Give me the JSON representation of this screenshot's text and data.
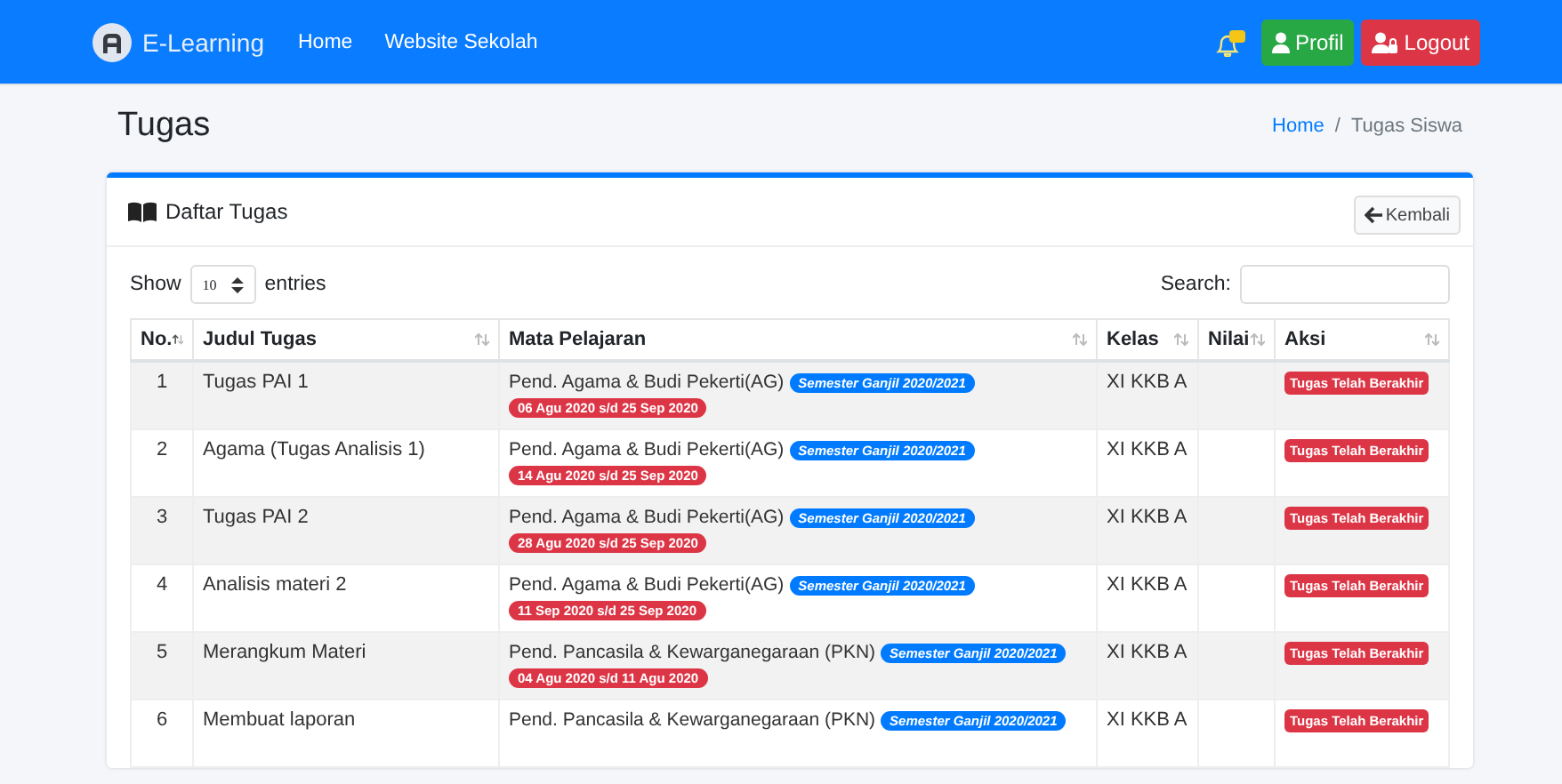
{
  "navbar": {
    "brand": "E-Learning",
    "links": [
      "Home",
      "Website Sekolah"
    ],
    "buttons": [
      {
        "label": "Profil",
        "kind": "profile"
      },
      {
        "label": "Logout",
        "kind": "logout"
      }
    ]
  },
  "page": {
    "title": "Tugas",
    "breadcrumb": [
      {
        "label": "Home",
        "selected": false
      },
      {
        "label": "Tugas Siswa",
        "selected": true
      }
    ],
    "breadcrumb_separator": "/"
  },
  "card": {
    "title": "Daftar Tugas",
    "back_button": "Kembali",
    "length": {
      "before": "Show",
      "value": "10",
      "after": "entries"
    },
    "search": {
      "label": "Search:"
    },
    "table": {
      "columns": [
        {
          "label": "No.",
          "sorted": true
        },
        {
          "label": "Judul Tugas",
          "sorted": false
        },
        {
          "label": "Mata Pelajaran",
          "sorted": false
        },
        {
          "label": "Kelas",
          "sorted": false
        },
        {
          "label": "Nilai",
          "sorted": false
        },
        {
          "label": "Aksi",
          "sorted": false
        }
      ],
      "rows": [
        {
          "no": "1",
          "title": "Tugas PAI 1",
          "subject": "Pend. Agama & Budi Pekerti(AG)",
          "semester": "Semester Ganjil 2020/2021",
          "period": "06 Agu 2020 s/d 25 Sep 2020",
          "class": "XI KKB A",
          "status": "Tugas Telah Berakhir"
        },
        {
          "no": "2",
          "title": "Agama (Tugas Analisis 1)",
          "subject": "Pend. Agama & Budi Pekerti(AG)",
          "semester": "Semester Ganjil 2020/2021",
          "period": "14 Agu 2020 s/d 25 Sep 2020",
          "class": "XI KKB A",
          "status": "Tugas Telah Berakhir"
        },
        {
          "no": "3",
          "title": "Tugas PAI 2",
          "subject": "Pend. Agama & Budi Pekerti(AG)",
          "semester": "Semester Ganjil 2020/2021",
          "period": "28 Agu 2020 s/d 25 Sep 2020",
          "class": "XI KKB A",
          "status": "Tugas Telah Berakhir"
        },
        {
          "no": "4",
          "title": "Analisis materi 2",
          "subject": "Pend. Agama & Budi Pekerti(AG)",
          "semester": "Semester Ganjil 2020/2021",
          "period": "11 Sep 2020 s/d 25 Sep 2020",
          "class": "XI KKB A",
          "status": "Tugas Telah Berakhir"
        },
        {
          "no": "5",
          "title": "Merangkum Materi",
          "subject": "Pend. Pancasila & Kewarganegaraan (PKN)",
          "semester": "Semester Ganjil 2020/2021",
          "period": "04 Agu 2020 s/d 11 Agu 2020",
          "class": "XI KKB A",
          "status": "Tugas Telah Berakhir"
        },
        {
          "no": "6",
          "title": "Membuat laporan",
          "subject": "Pend. Pancasila & Kewarganegaraan (PKN)",
          "semester": "Semester Ganjil 2020/2021",
          "class": "XI KKB A",
          "status": "Tugas Telah Berakhir"
        }
      ]
    }
  }
}
